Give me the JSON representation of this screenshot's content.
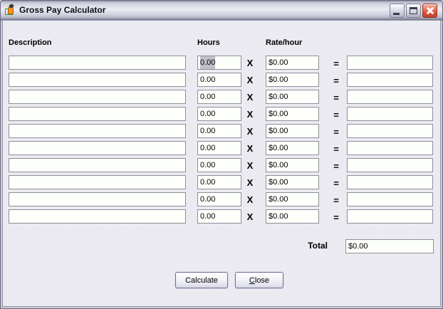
{
  "window": {
    "title": "Gross Pay Calculator",
    "icons": {
      "app": "form-icon",
      "minimize": "minimize-icon",
      "maximize": "maximize-icon",
      "close": "close-icon"
    }
  },
  "columns": {
    "description": "Description",
    "hours": "Hours",
    "rate": "Rate/hour"
  },
  "operators": {
    "multiply": "X",
    "equals": "="
  },
  "rows": [
    {
      "description": "",
      "hours": "0.00",
      "hours_selected": true,
      "rate": "$0.00",
      "result": ""
    },
    {
      "description": "",
      "hours": "0.00",
      "hours_selected": false,
      "rate": "$0.00",
      "result": ""
    },
    {
      "description": "",
      "hours": "0.00",
      "hours_selected": false,
      "rate": "$0.00",
      "result": ""
    },
    {
      "description": "",
      "hours": "0.00",
      "hours_selected": false,
      "rate": "$0.00",
      "result": ""
    },
    {
      "description": "",
      "hours": "0.00",
      "hours_selected": false,
      "rate": "$0.00",
      "result": ""
    },
    {
      "description": "",
      "hours": "0.00",
      "hours_selected": false,
      "rate": "$0.00",
      "result": ""
    },
    {
      "description": "",
      "hours": "0.00",
      "hours_selected": false,
      "rate": "$0.00",
      "result": ""
    },
    {
      "description": "",
      "hours": "0.00",
      "hours_selected": false,
      "rate": "$0.00",
      "result": ""
    },
    {
      "description": "",
      "hours": "0.00",
      "hours_selected": false,
      "rate": "$0.00",
      "result": ""
    },
    {
      "description": "",
      "hours": "0.00",
      "hours_selected": false,
      "rate": "$0.00",
      "result": ""
    }
  ],
  "total": {
    "label": "Total",
    "value": "$0.00"
  },
  "buttons": {
    "calculate": {
      "label": "Calculate"
    },
    "close": {
      "label": "Close",
      "accesskey_index": 0
    }
  },
  "colors": {
    "titlebar_inactive_silver": "#d6d6e2",
    "close_button_red": "#d44f36",
    "field_background": "#fdfffa",
    "field_border": "#8f8f9b",
    "inactive_selection": "#bfbfc9",
    "client_background": "#e8e7ee"
  }
}
